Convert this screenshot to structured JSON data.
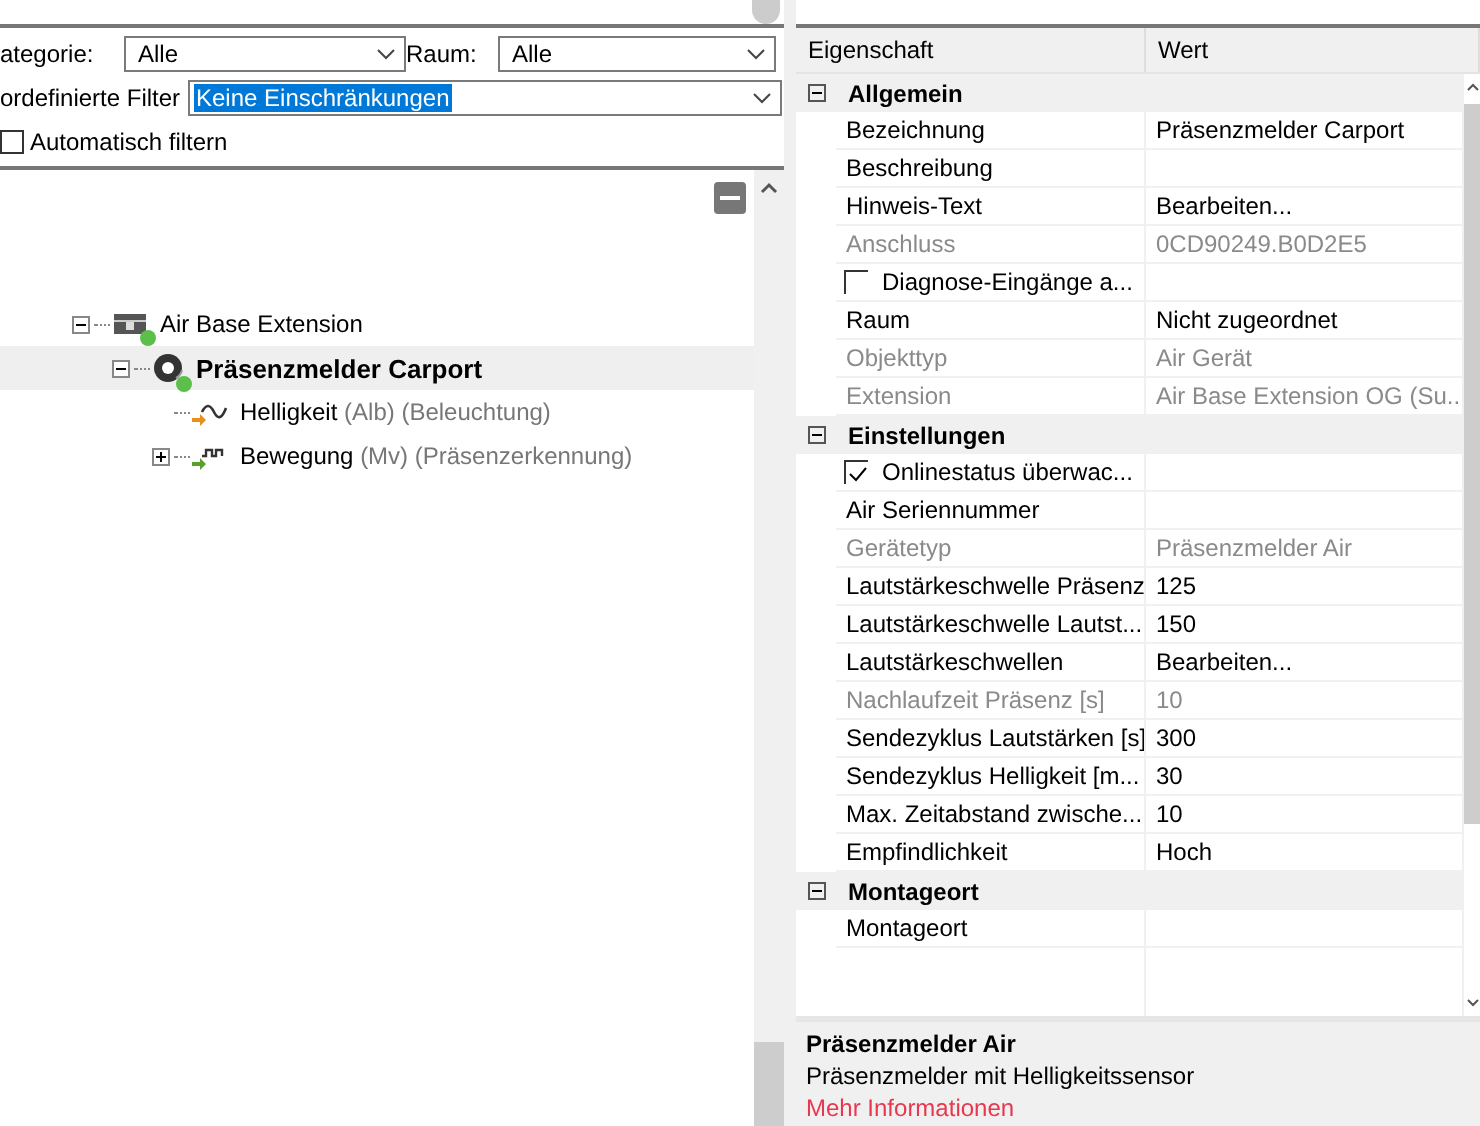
{
  "filters": {
    "category": {
      "label": "ategorie:",
      "value": "Alle"
    },
    "room": {
      "label": "Raum:",
      "value": "Alle"
    },
    "preset": {
      "label": "ordefinierte Filter",
      "value": "Keine Einschränkungen",
      "highlighted": true
    },
    "auto_filter": {
      "label": "Automatisch filtern",
      "checked": false
    }
  },
  "tree": {
    "nodes": [
      {
        "name": "Air Base Extension",
        "kind": "extension",
        "online": true,
        "expanded": true,
        "selected": false,
        "children": [
          {
            "name": "Präsenzmelder Carport",
            "kind": "sensor",
            "online": true,
            "expanded": true,
            "selected": true,
            "children": [
              {
                "name": "Helligkeit",
                "detail": "(Alb) (Beleuchtung)",
                "kind": "brightness",
                "online": false,
                "selected": false
              },
              {
                "name": "Bewegung",
                "detail": "(Mv) (Präsenzerkennung)",
                "kind": "motion",
                "online": false,
                "expanded": false,
                "selected": false
              }
            ]
          }
        ]
      }
    ]
  },
  "properties": {
    "columns": [
      "Eigenschaft",
      "Wert"
    ],
    "groups": [
      {
        "title": "Allgemein",
        "expanded": true,
        "items": [
          {
            "kind": "text",
            "name": "Bezeichnung",
            "value": "Präsenzmelder Carport",
            "disabled": false
          },
          {
            "kind": "text",
            "name": "Beschreibung",
            "disabled": false
          },
          {
            "kind": "text",
            "name": "Hinweis-Text",
            "value": "Bearbeiten...",
            "disabled": false
          },
          {
            "kind": "text",
            "name": "Anschluss",
            "value": "0CD90249.B0D2E5",
            "disabled": true
          },
          {
            "kind": "check",
            "name": "Diagnose-Eingänge a...",
            "checked": false
          },
          {
            "kind": "text",
            "name": "Raum",
            "value": "Nicht zugeordnet",
            "disabled": false
          },
          {
            "kind": "text",
            "name": "Objekttyp",
            "value": "Air Gerät",
            "disabled": true
          },
          {
            "kind": "text",
            "name": "Extension",
            "value": "Air Base Extension OG (Su...",
            "disabled": true
          }
        ]
      },
      {
        "title": "Einstellungen",
        "expanded": true,
        "items": [
          {
            "kind": "check",
            "name": "Onlinestatus überwac...",
            "checked": true
          },
          {
            "kind": "text",
            "name": "Air Seriennummer",
            "disabled": false
          },
          {
            "kind": "text",
            "name": "Gerätetyp",
            "value": "Präsenzmelder Air",
            "disabled": true
          },
          {
            "kind": "text",
            "name": "Lautstärkeschwelle Präsenz",
            "value": "125",
            "disabled": false
          },
          {
            "kind": "text",
            "name": "Lautstärkeschwelle Lautst...",
            "value": "150",
            "disabled": false
          },
          {
            "kind": "text",
            "name": "Lautstärkeschwellen",
            "value": "Bearbeiten...",
            "disabled": false
          },
          {
            "kind": "text",
            "name": "Nachlaufzeit Präsenz [s]",
            "value": "10",
            "disabled": true
          },
          {
            "kind": "text",
            "name": "Sendezyklus Lautstärken [s]",
            "value": "300",
            "disabled": false
          },
          {
            "kind": "text",
            "name": "Sendezyklus Helligkeit [m...",
            "value": "30",
            "disabled": false
          },
          {
            "kind": "text",
            "name": "Max. Zeitabstand zwische...",
            "value": "10",
            "disabled": false
          },
          {
            "kind": "text",
            "name": "Empfindlichkeit",
            "value": "Hoch",
            "disabled": false
          }
        ]
      },
      {
        "title": "Montageort",
        "expanded": true,
        "items": [
          {
            "kind": "text",
            "name": "Montageort",
            "disabled": false
          }
        ]
      }
    ]
  },
  "description": {
    "title": "Präsenzmelder Air",
    "text": "Präsenzmelder mit Helligkeitssensor",
    "link": "Mehr Informationen"
  }
}
